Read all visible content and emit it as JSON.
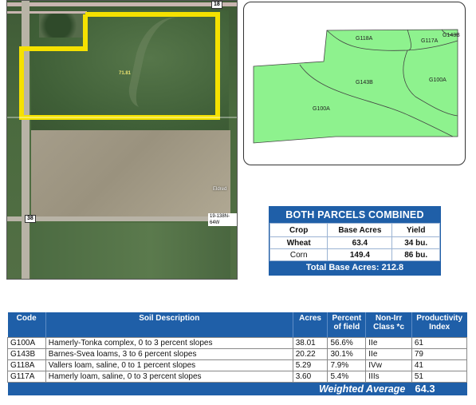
{
  "aerial": {
    "road_shields": [
      "18",
      "38"
    ],
    "acre_label": "71.81",
    "place_label": "Eldred",
    "township_label": "19-138N-64W",
    "parcel_outline_color": "#f5e100"
  },
  "soil_map": {
    "fill_color": "#8ef28e",
    "labels": [
      "G118A",
      "G117A",
      "G143B",
      "G100A",
      "G143B",
      "G100A"
    ]
  },
  "parcels": {
    "title": "BOTH PARCELS COMBINED",
    "headers": [
      "Crop",
      "Base Acres",
      "Yield"
    ],
    "rows": [
      {
        "crop": "Wheat",
        "base_acres": "63.4",
        "yield": "34 bu."
      },
      {
        "crop": "Corn",
        "base_acres": "149.4",
        "yield": "86 bu."
      }
    ],
    "total": "Total Base Acres: 212.8",
    "accent_color": "#1f5fa8"
  },
  "soils": {
    "headers": {
      "code": "Code",
      "description": "Soil Description",
      "acres": "Acres",
      "percent_1": "Percent",
      "percent_2": "of field",
      "class_1": "Non-Irr",
      "class_2": "Class *c",
      "prod_1": "Productivity",
      "prod_2": "Index"
    },
    "rows": [
      {
        "code": "G100A",
        "description": "Hamerly-Tonka complex, 0 to 3 percent slopes",
        "acres": "38.01",
        "percent": "56.6%",
        "class": "IIe",
        "index": "61"
      },
      {
        "code": "G143B",
        "description": "Barnes-Svea loams, 3 to 6 percent slopes",
        "acres": "20.22",
        "percent": "30.1%",
        "class": "IIe",
        "index": "79"
      },
      {
        "code": "G118A",
        "description": "Vallers loam, saline, 0 to 1 percent slopes",
        "acres": "5.29",
        "percent": "7.9%",
        "class": "IVw",
        "index": "41"
      },
      {
        "code": "G117A",
        "description": "Hamerly loam, saline, 0 to 3 percent slopes",
        "acres": "3.60",
        "percent": "5.4%",
        "class": "IIIs",
        "index": "51"
      }
    ],
    "weighted_label": "Weighted Average",
    "weighted_value": "64.3"
  }
}
